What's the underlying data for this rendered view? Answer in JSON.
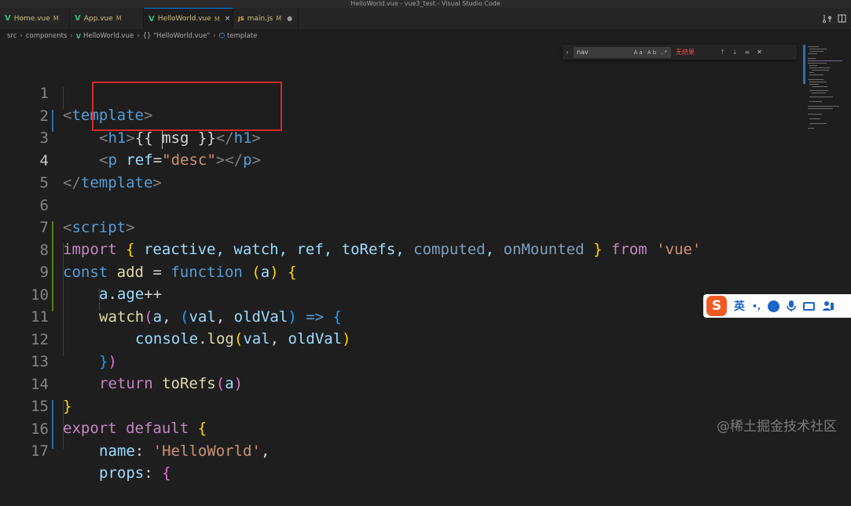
{
  "window_title": "HelloWorld.vue - vue3_test - Visual Studio Code",
  "tabs": [
    {
      "icon": "V",
      "name": "Home.vue",
      "badge": "M"
    },
    {
      "icon": "V",
      "name": "App.vue",
      "badge": "M"
    },
    {
      "icon": "V",
      "name": "HelloWorld.vue",
      "badge": "M",
      "close": "×"
    },
    {
      "icon": "JS",
      "name": "main.js",
      "badge": "M",
      "dot": "●"
    }
  ],
  "breadcrumb": [
    "src",
    "components",
    "HelloWorld.vue",
    "{} \"HelloWorld.vue\"",
    "template"
  ],
  "find": {
    "toggle": "›",
    "query": "nav",
    "options": "Aa  Ab  .*",
    "result": "无结果",
    "prev": "↑",
    "next": "↓",
    "selection": "≡",
    "close": "✕"
  },
  "ime": {
    "lang": "英",
    "punct": "•,"
  },
  "watermark": "@稀土掘金技术社区",
  "code": {
    "lines": [
      "1",
      "2",
      "3",
      "4",
      "5",
      "6",
      "7",
      "8",
      "9",
      "10",
      "11",
      "12",
      "13",
      "14",
      "15",
      "16",
      "17"
    ],
    "l1": [
      "<",
      "template",
      ">"
    ],
    "l2": [
      "<",
      "h1",
      ">",
      "{{ msg }}",
      "</",
      "h1",
      ">"
    ],
    "l3": [
      "<",
      "p",
      " ",
      "ref",
      "=",
      "\"desc\"",
      ">",
      "</",
      "p",
      ">"
    ],
    "l4": [
      "</",
      "template",
      ">"
    ],
    "l6": [
      "<",
      "script",
      ">"
    ],
    "l7": [
      "import",
      " ",
      "{",
      " reactive, watch, ref, toRefs, ",
      "computed",
      ", ",
      "onMounted",
      " ",
      "}",
      " from ",
      "'vue'"
    ],
    "l8": [
      "const",
      " ",
      "add",
      " = ",
      "function",
      " ",
      "(",
      "a",
      ")",
      " ",
      "{"
    ],
    "l9": [
      "a",
      ".",
      "age",
      "++"
    ],
    "l10": [
      "watch",
      "(",
      "a",
      ", ",
      "(",
      "val",
      ", ",
      "oldVal",
      ")",
      " => ",
      "{"
    ],
    "l11": [
      "console",
      ".",
      "log",
      "(",
      "val",
      ", ",
      "oldVal",
      ")"
    ],
    "l12": [
      "}",
      ")"
    ],
    "l13": [
      "return",
      " ",
      "toRefs",
      "(",
      "a",
      ")"
    ],
    "l14": [
      "}"
    ],
    "l15": [
      "export",
      " ",
      "default",
      " ",
      "{"
    ],
    "l16": [
      "name",
      ": ",
      "'HelloWorld'",
      ","
    ],
    "l17": [
      "props",
      ": ",
      "{"
    ]
  },
  "colors": {
    "accent": "#007acc",
    "highlight_box": "#d42a2a",
    "find_no_result": "#f14c4c"
  }
}
